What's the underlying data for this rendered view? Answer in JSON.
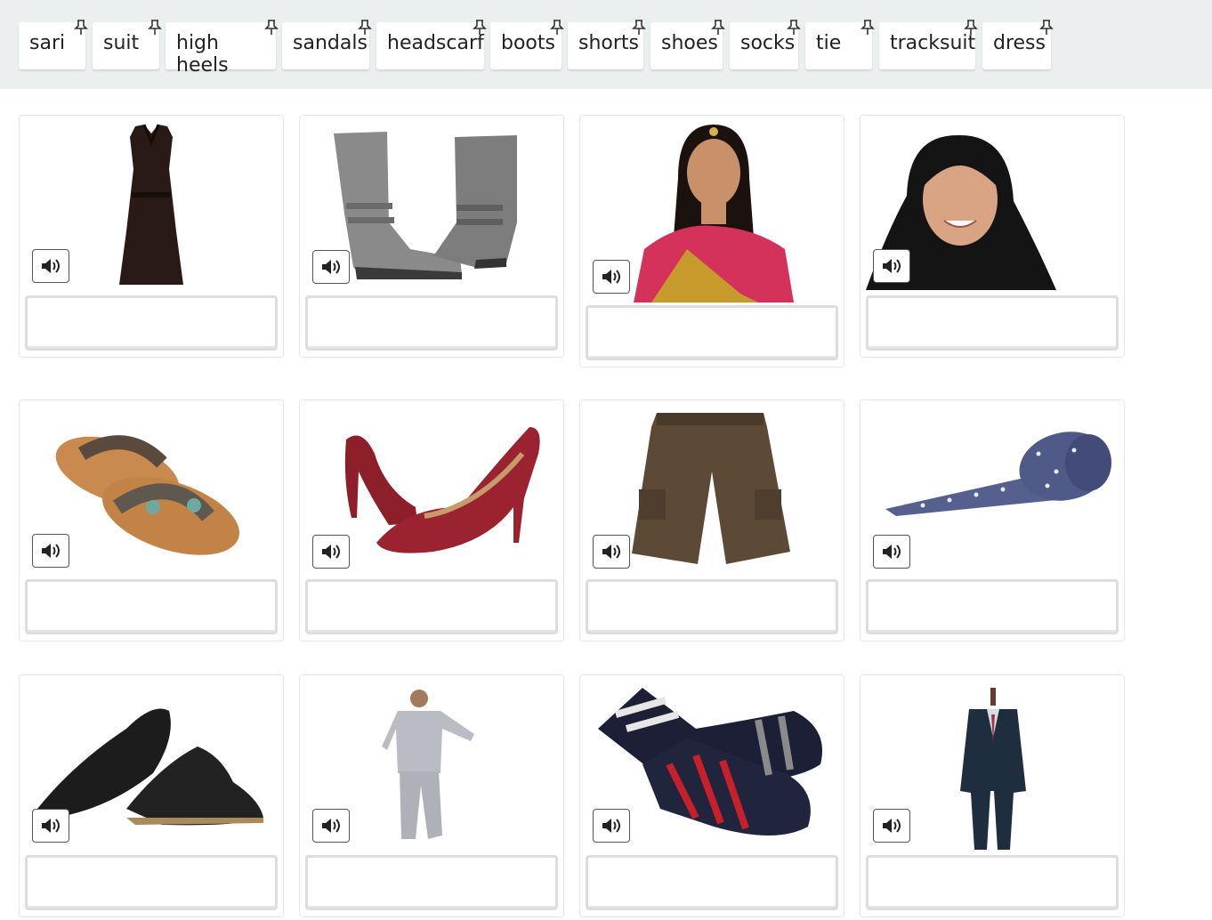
{
  "word_bank": [
    "sari",
    "suit",
    "high heels",
    "sandals",
    "headscarf",
    "boots",
    "shorts",
    "shoes",
    "socks",
    "tie",
    "tracksuit",
    "dress"
  ],
  "cards": [
    {
      "picture": "dress",
      "drop_value": ""
    },
    {
      "picture": "boots",
      "drop_value": ""
    },
    {
      "picture": "sari",
      "drop_value": ""
    },
    {
      "picture": "headscarf",
      "drop_value": ""
    },
    {
      "picture": "sandals",
      "drop_value": ""
    },
    {
      "picture": "high heels",
      "drop_value": ""
    },
    {
      "picture": "shorts",
      "drop_value": ""
    },
    {
      "picture": "tie",
      "drop_value": ""
    },
    {
      "picture": "shoes",
      "drop_value": ""
    },
    {
      "picture": "tracksuit",
      "drop_value": ""
    },
    {
      "picture": "socks",
      "drop_value": ""
    },
    {
      "picture": "suit",
      "drop_value": ""
    }
  ],
  "icons": {
    "chip_pin": "thumbtack-icon",
    "audio": "speaker-icon"
  },
  "colors": {
    "bank_background": "#eceff0",
    "chip_background": "#ffffff",
    "drop_border": "#dddddd"
  }
}
